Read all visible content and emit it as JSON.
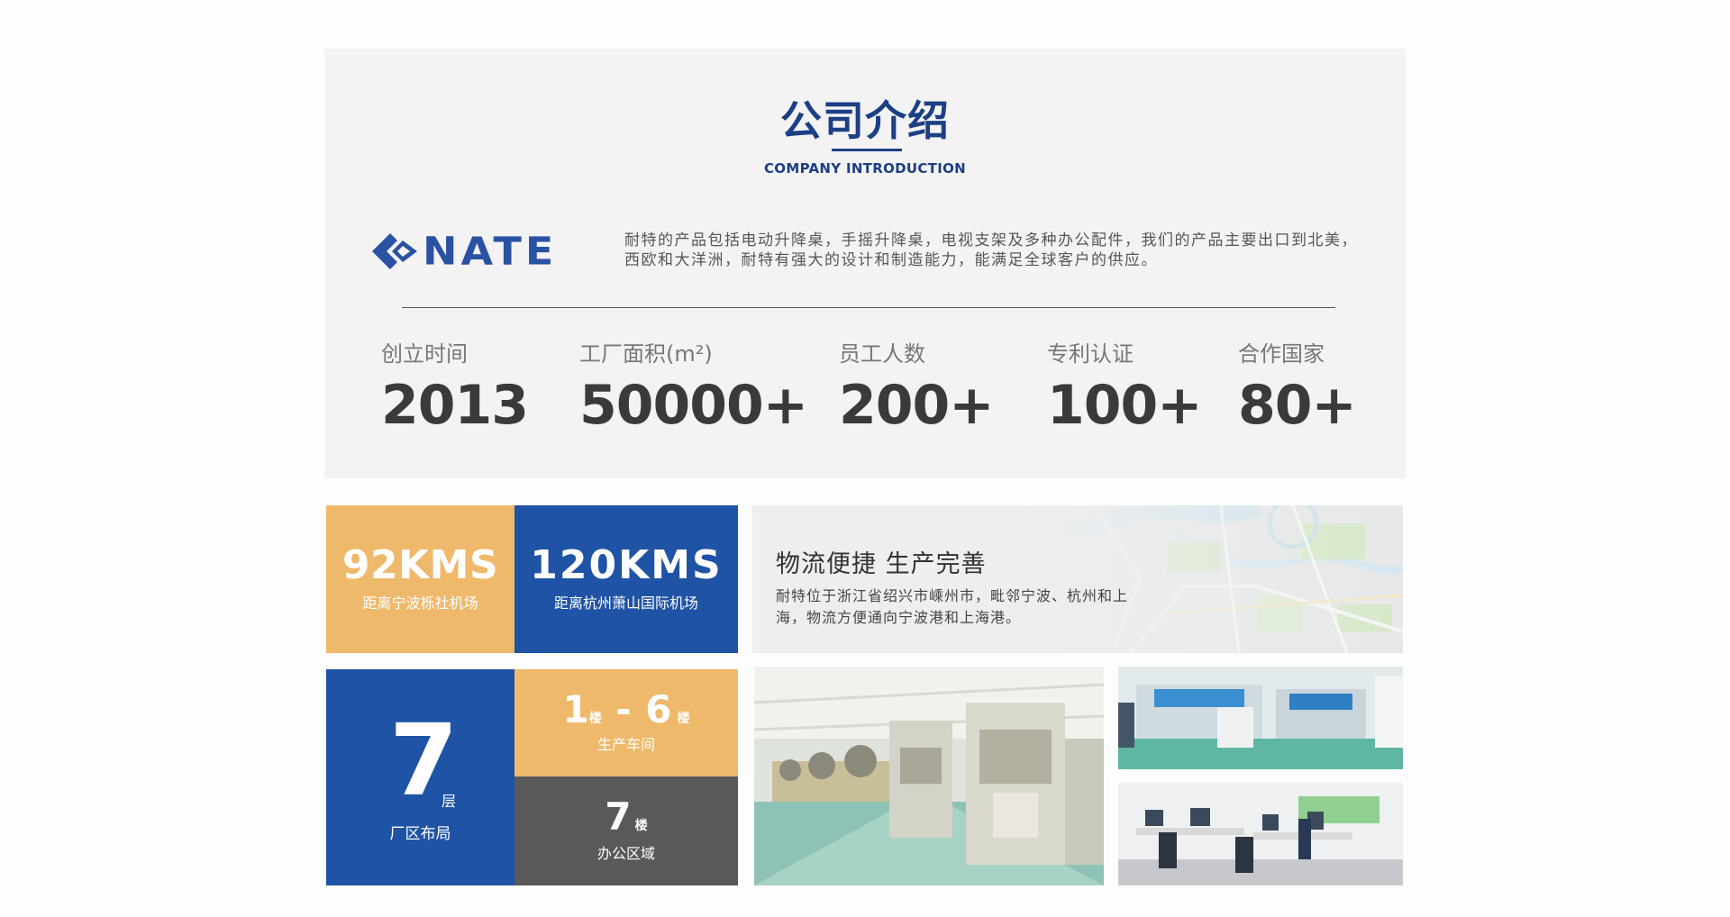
{
  "intro": {
    "title_cn": "公司介绍",
    "title_en": "COMPANY INTRODUCTION",
    "logo_text": "NATE",
    "description": "耐特的产品包括电动升降桌，手摇升降桌，电视支架及多种办公配件，我们的产品主要出口到北美，西欧和大洋洲，耐特有强大的设计和制造能力，能满足全球客户的供应。",
    "brand_color": "#1c3f85"
  },
  "stats": [
    {
      "label": "创立时间",
      "value": "2013"
    },
    {
      "label": "工厂面积(m²)",
      "value": "50000+"
    },
    {
      "label": "员工人数",
      "value": "200+"
    },
    {
      "label": "专利认证",
      "value": "100+"
    },
    {
      "label": "合作国家",
      "value": "80+"
    }
  ],
  "tiles": {
    "ningbo": {
      "value": "92KMS",
      "label": "距离宁波栎社机场"
    },
    "hangzhou": {
      "value": "120KMS",
      "label": "距离杭州萧山国际机场"
    },
    "floors": {
      "value": "7",
      "unit": "层",
      "label": "厂区布局"
    },
    "production": {
      "from": "1",
      "from_unit": "楼",
      "sep": "-",
      "to": "6",
      "to_unit": "楼",
      "label": "生产车间"
    },
    "office": {
      "value": "7",
      "unit": "楼",
      "label": "办公区域"
    }
  },
  "logistics": {
    "title": "物流便捷 生产完善",
    "description": "耐特位于浙江省绍兴市嵊州市，毗邻宁波、杭州和上海，物流方便通向宁波港和上海港。"
  },
  "colors": {
    "orange": "#efb96b",
    "blue": "#1f53a5",
    "dark": "#595959"
  }
}
